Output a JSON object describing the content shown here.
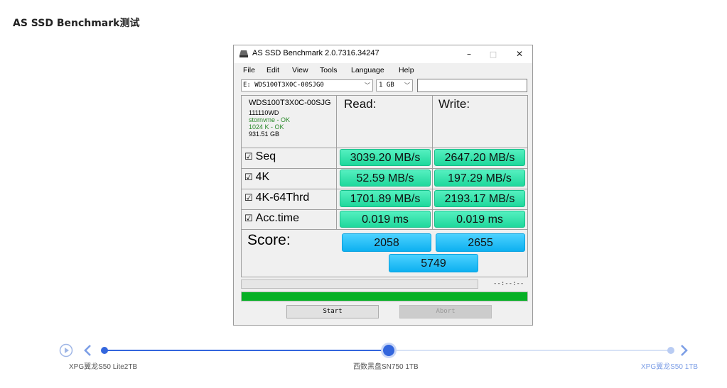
{
  "page": {
    "title": "AS SSD Benchmark测试"
  },
  "window": {
    "title": "AS SSD Benchmark 2.0.7316.34247",
    "controls": {
      "minimize": "–",
      "maximize": "□",
      "close": "✕"
    },
    "menu": [
      "File",
      "Edit",
      "View",
      "Tools",
      "Language",
      "Help"
    ],
    "drive_select": "E: WDS100T3X0C-00SJG0",
    "size_select": "1 GB",
    "info": {
      "model": "WDS100T3X0C-00SJG",
      "firmware": "111110WD",
      "driver": "stornvme - OK",
      "alignment": "1024 K - OK",
      "capacity": "931.51 GB"
    },
    "headers": {
      "read": "Read:",
      "write": "Write:"
    },
    "rows": [
      {
        "label": "Seq",
        "read": "3039.20 MB/s",
        "write": "2647.20 MB/s"
      },
      {
        "label": "4K",
        "read": "52.59 MB/s",
        "write": "197.29 MB/s"
      },
      {
        "label": "4K-64Thrd",
        "read": "1701.89 MB/s",
        "write": "2193.17 MB/s"
      },
      {
        "label": "Acc.time",
        "read": "0.019 ms",
        "write": "0.019 ms"
      }
    ],
    "checkbox_glyph": "☑",
    "score": {
      "label": "Score:",
      "read": "2058",
      "write": "2655",
      "total": "5749"
    },
    "progress_time": "--:--:--",
    "progress_complete": 1.0,
    "buttons": {
      "start": "Start",
      "abort": "Abort"
    },
    "colors": {
      "result": "#1fd89c",
      "score": "#0db0f0",
      "progress": "#06b025"
    }
  },
  "timeline": {
    "items": [
      {
        "label": "XPG翼龙S50 Lite2TB",
        "state": "visited"
      },
      {
        "label": "西数黑盘SN750 1TB",
        "state": "current"
      },
      {
        "label": "XPG翼龙S50 1TB",
        "state": "upcoming"
      }
    ],
    "accent": "#3366dd"
  }
}
